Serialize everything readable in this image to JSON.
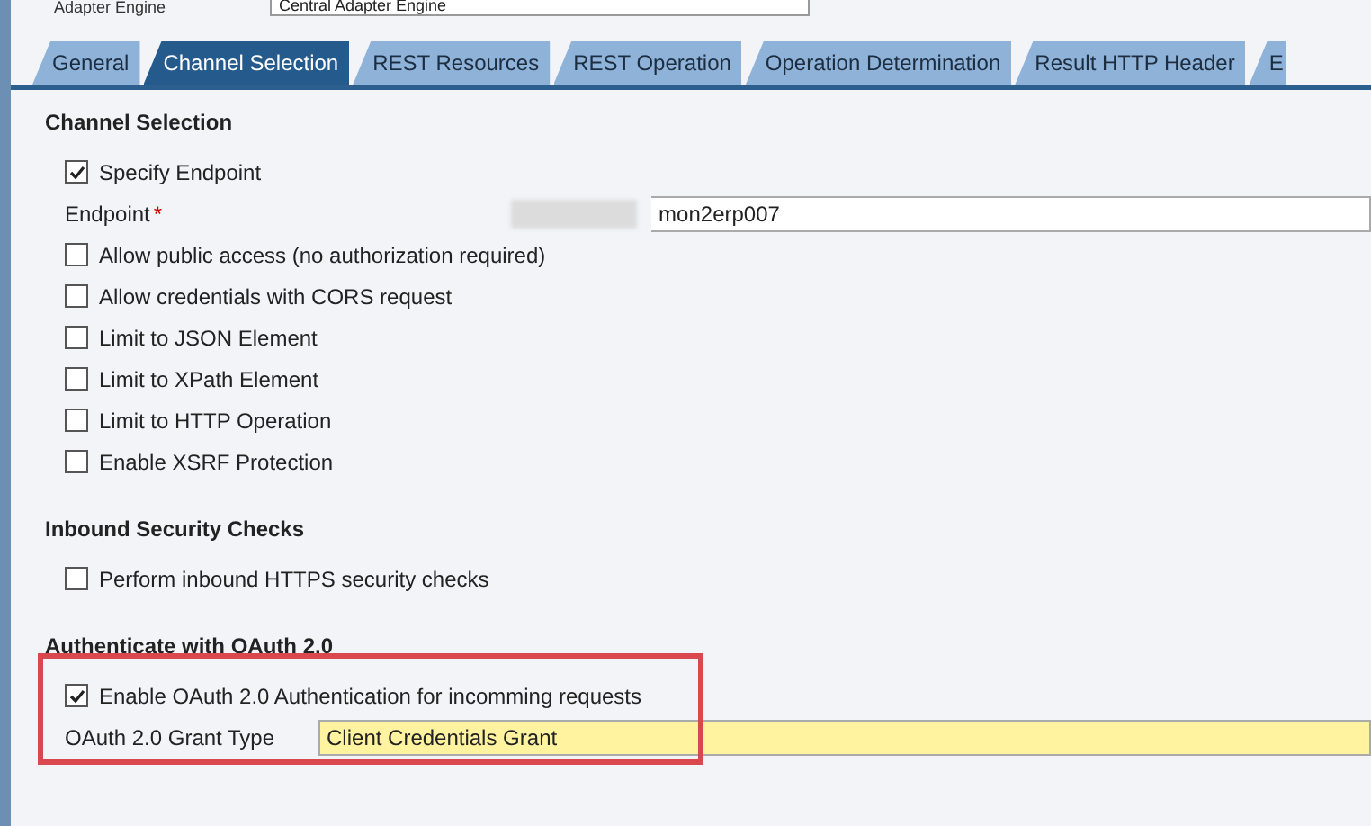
{
  "header": {
    "label": "Adapter Engine",
    "value": "Central Adapter Engine"
  },
  "tabs": [
    {
      "label": "General",
      "selected": false
    },
    {
      "label": "Channel Selection",
      "selected": true
    },
    {
      "label": "REST Resources",
      "selected": false
    },
    {
      "label": "REST Operation",
      "selected": false
    },
    {
      "label": "Operation Determination",
      "selected": false
    },
    {
      "label": "Result HTTP Header",
      "selected": false
    },
    {
      "label": "E",
      "selected": false
    }
  ],
  "sections": [
    {
      "title": "Channel Selection",
      "highlighted": false,
      "items": [
        {
          "kind": "checkbox",
          "label": "Specify Endpoint",
          "checked": true
        },
        {
          "kind": "field",
          "label": "Endpoint",
          "required_mark": "*",
          "value": "mon2erp007",
          "redacted": true,
          "filled": false
        },
        {
          "kind": "checkbox",
          "label": "Allow public access (no authorization required)",
          "checked": false
        },
        {
          "kind": "checkbox",
          "label": "Allow credentials with CORS request",
          "checked": false
        },
        {
          "kind": "checkbox",
          "label": "Limit to JSON Element",
          "checked": false
        },
        {
          "kind": "checkbox",
          "label": "Limit to XPath Element",
          "checked": false
        },
        {
          "kind": "checkbox",
          "label": "Limit to HTTP Operation",
          "checked": false
        },
        {
          "kind": "checkbox",
          "label": "Enable XSRF Protection",
          "checked": false
        }
      ]
    },
    {
      "title": "Inbound Security Checks",
      "highlighted": false,
      "items": [
        {
          "kind": "checkbox",
          "label": "Perform inbound HTTPS security checks",
          "checked": false
        }
      ]
    },
    {
      "title": "Authenticate with OAuth 2.0",
      "highlighted": true,
      "items": [
        {
          "kind": "checkbox",
          "label": "Enable OAuth 2.0 Authentication for incomming requests",
          "checked": true
        },
        {
          "kind": "field",
          "label": "OAuth 2.0 Grant Type",
          "value": "Client Credentials Grant",
          "filled": true
        }
      ]
    }
  ]
}
